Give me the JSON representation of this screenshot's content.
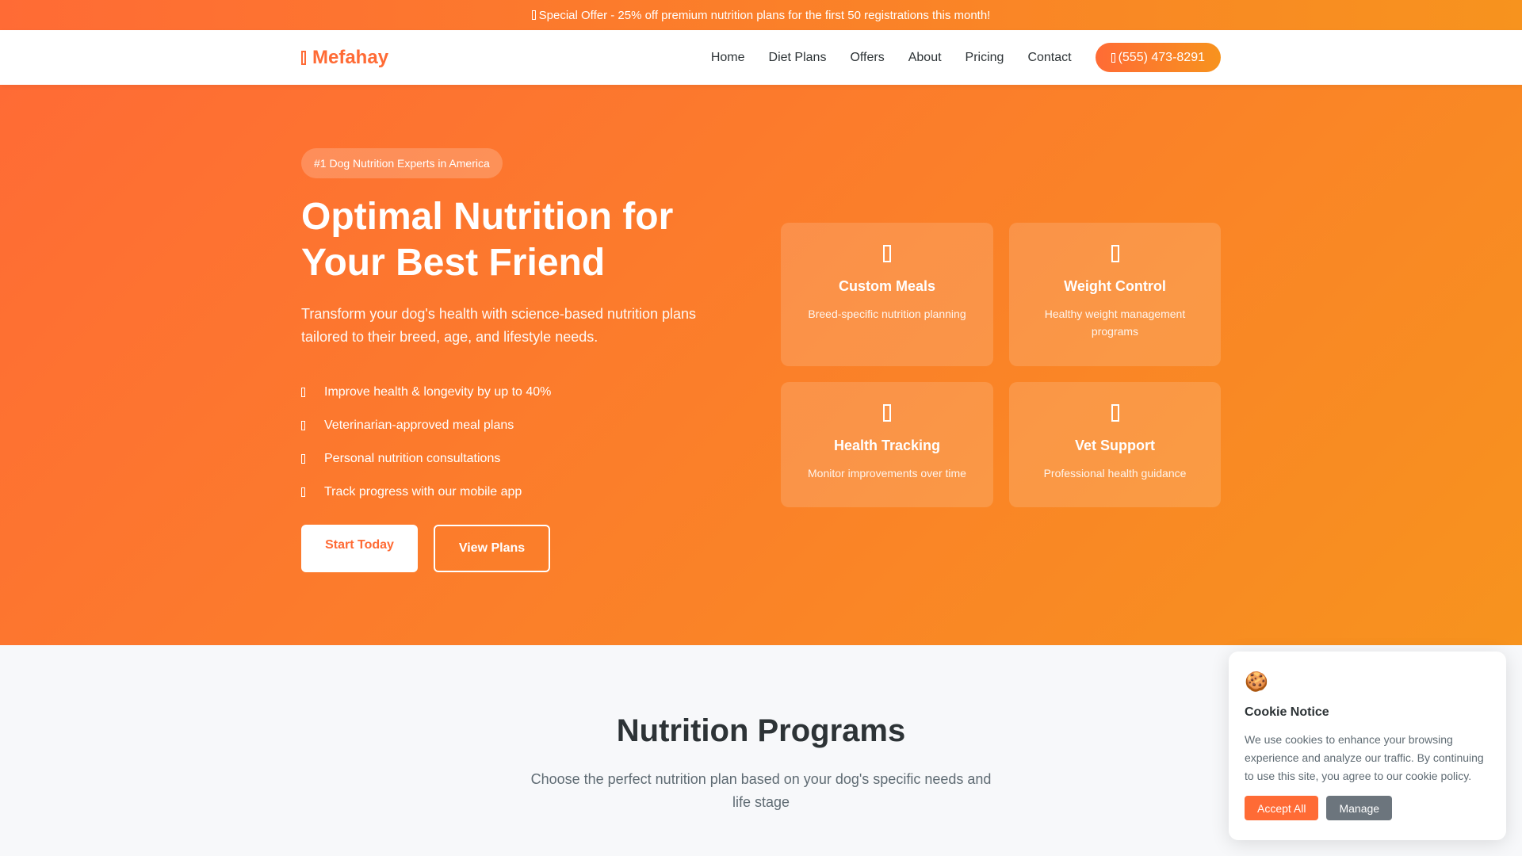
{
  "topbar": {
    "text": "Special Offer - 25% off premium nutrition plans for the first 50 registrations this month!",
    "icon": "tag-icon"
  },
  "nav": {
    "logo_text": "Mefahay",
    "logo_icon": "paw-icon",
    "links": [
      "Home",
      "Diet Plans",
      "Offers",
      "About",
      "Pricing",
      "Contact"
    ],
    "phone_label": "(555) 473-8291",
    "phone_icon": "phone-icon"
  },
  "hero": {
    "badge": "#1 Dog Nutrition Experts in America",
    "title": "Optimal Nutrition for Your Best Friend",
    "subtitle": "Transform your dog's health with science-based nutrition plans tailored to their breed, age, and lifestyle needs.",
    "features": [
      "Improve health & longevity by up to 40%",
      "Veterinarian-approved meal plans",
      "Personal nutrition consultations",
      "Track progress with our mobile app"
    ],
    "primary_button": "Start Today",
    "secondary_button": "View Plans"
  },
  "feature_cards": [
    {
      "icon": "meal-icon",
      "title": "Custom Meals",
      "desc": "Breed-specific nutrition planning"
    },
    {
      "icon": "weight-icon",
      "title": "Weight Control",
      "desc": "Healthy weight management programs"
    },
    {
      "icon": "heartbeat-icon",
      "title": "Health Tracking",
      "desc": "Monitor improvements over time"
    },
    {
      "icon": "vet-icon",
      "title": "Vet Support",
      "desc": "Professional health guidance"
    }
  ],
  "programs": {
    "title": "Nutrition Programs",
    "subtitle": "Choose the perfect nutrition plan based on your dog's specific needs and life stage"
  },
  "cookie": {
    "emoji": "🍪",
    "title": "Cookie Notice",
    "text": "We use cookies to enhance your browsing experience and analyze our traffic. By continuing to use this site, you agree to our cookie policy.",
    "accept_label": "Accept All",
    "manage_label": "Manage"
  },
  "colors": {
    "accent": "#ff6b35",
    "accent_alt": "#f7931e",
    "text": "#2d3336",
    "manage_button": "#6c757d"
  }
}
